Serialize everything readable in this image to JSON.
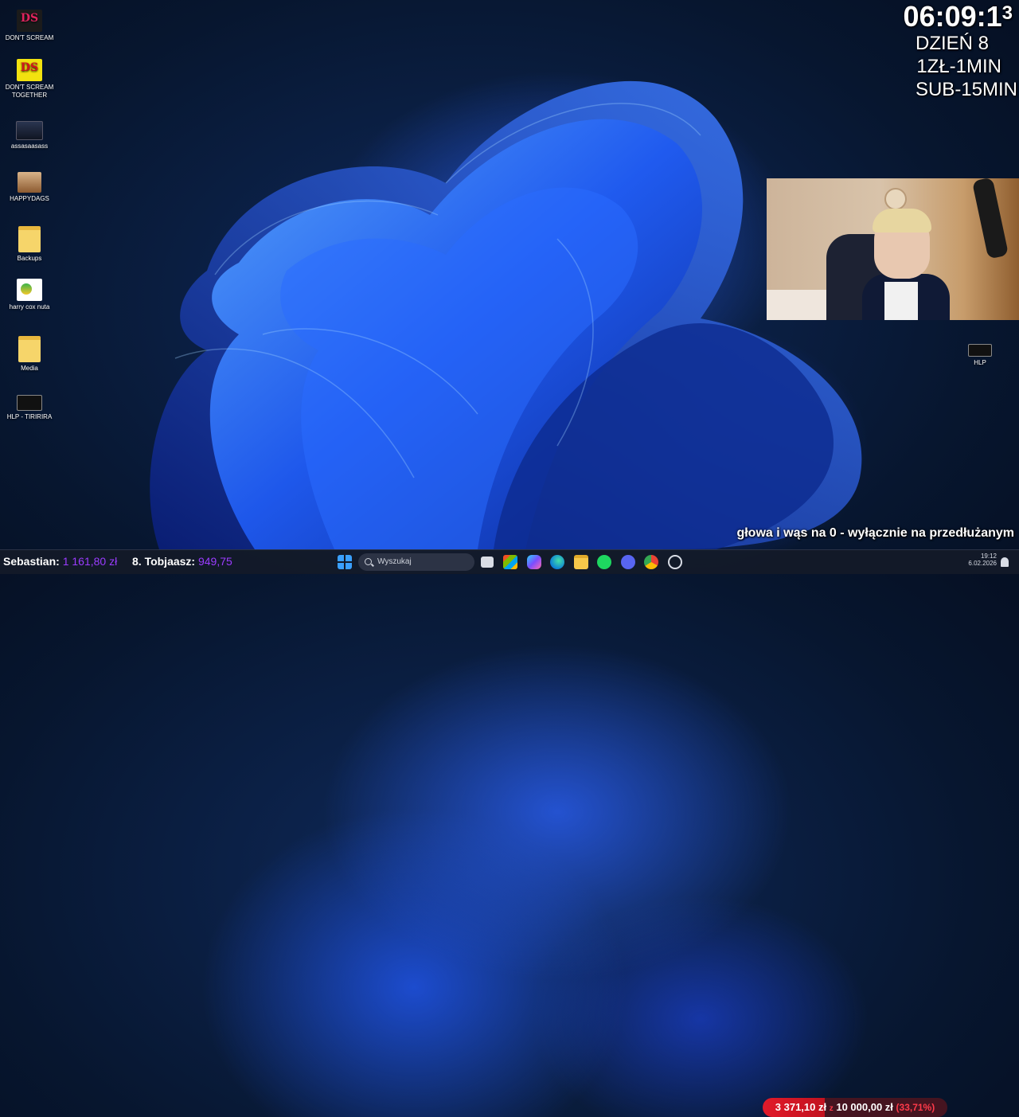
{
  "desktop": {
    "icons": [
      {
        "label": "DON'T SCREAM"
      },
      {
        "label": "DON'T SCREAM TOGETHER"
      },
      {
        "label": "assasaasass"
      },
      {
        "label": "HAPPYDAGS"
      },
      {
        "label": "Backups"
      },
      {
        "label": "harry cox nuta"
      },
      {
        "label": "Media"
      },
      {
        "label": "HLP - TIRIRIRA"
      },
      {
        "label": "HLP"
      }
    ]
  },
  "overlay": {
    "clock": "06:09:1",
    "clock_last_digit": "3",
    "day": "DZIEŃ 8",
    "rate_money": "1ZŁ-1MIN",
    "rate_sub": "SUB-15MIN",
    "ticker": "głowa i wąs na 0 - wyłącznie na przedłużanym"
  },
  "taskbar": {
    "top_donor_name": "Sebastian:",
    "top_donor_amount": "1 161,80 zł",
    "rank_label": "8. Tobjaasz:",
    "rank_amount": "949,75",
    "search_placeholder": "Wyszukaj",
    "goal": {
      "current": "3 371,10 zł",
      "separator": "z",
      "target": "10 000,00 zł",
      "percent": "(33,71%)",
      "progress": 0.3371
    },
    "time": "19:12",
    "date": "6.02.2026"
  },
  "colors": {
    "accent": "#9b3cff",
    "goal_red": "#e11a2a"
  }
}
